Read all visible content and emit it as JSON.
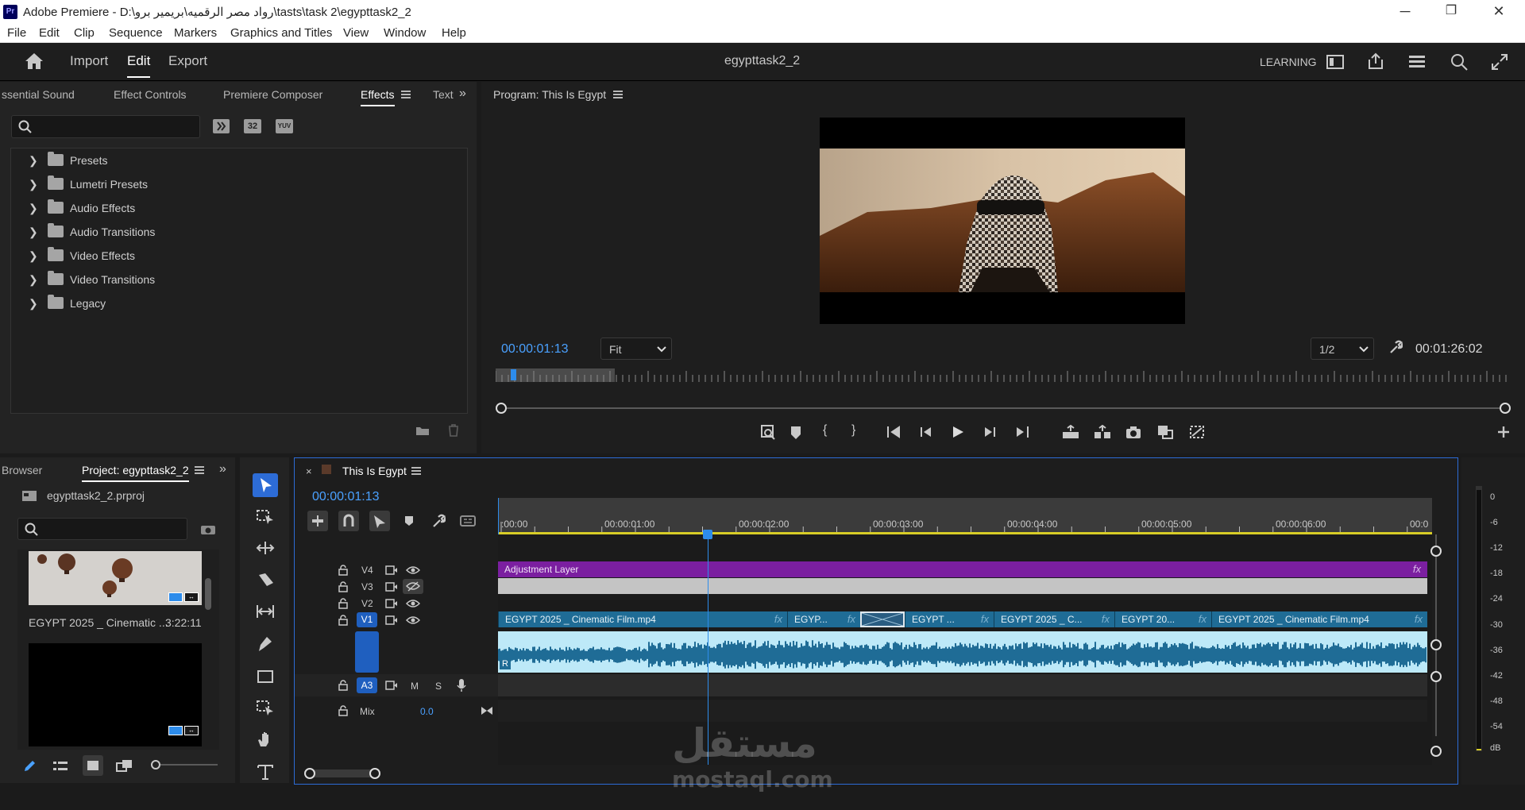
{
  "title_bar": {
    "app_logo": "Pr",
    "title": "Adobe Premiere - D:\\رواد مصر الرقميه\\بريمير برو\\tasts\\task 2\\egypttask2_2",
    "minimize": "─",
    "maximize": "❐",
    "close": "✕"
  },
  "menu": [
    "File",
    "Edit",
    "Clip",
    "Sequence",
    "Markers",
    "Graphics and Titles",
    "View",
    "Window",
    "Help"
  ],
  "workspace": {
    "tabs": [
      "Import",
      "Edit",
      "Export"
    ],
    "active": "Edit",
    "project_title": "egypttask2_2",
    "learning": "LEARNING"
  },
  "effects_panel": {
    "tabs": [
      "ssential Sound",
      "Effect Controls",
      "Premiere Composer",
      "Effects",
      "Text"
    ],
    "active_tab": "Effects",
    "search_placeholder": "",
    "filter_icons": [
      "accelerated-effects-icon",
      "32-bit-icon",
      "yuv-icon"
    ],
    "filter_labels": [
      "32",
      "YUV"
    ],
    "tree": [
      "Presets",
      "Lumetri Presets",
      "Audio Effects",
      "Audio Transitions",
      "Video Effects",
      "Video Transitions",
      "Legacy"
    ]
  },
  "program_monitor": {
    "title": "Program: This Is Egypt",
    "timecode": "00:00:01:13",
    "zoom": "Fit",
    "resolution": "1/2",
    "duration": "00:01:26:02",
    "playhead_fraction": 0.017
  },
  "project_panel": {
    "tabs": [
      "Browser",
      "Project: egypttask2_2"
    ],
    "active_tab": "Project: egypttask2_2",
    "file_name": "egypttask2_2.prproj",
    "search_placeholder": "",
    "items": [
      {
        "name": "EGYPT 2025 _ Cinematic ...",
        "duration": "3:22:11"
      }
    ]
  },
  "timeline": {
    "close": "×",
    "sequence_name": "This Is Egypt",
    "timecode": "00:00:01:13",
    "ruler_labels": [
      ":00:00",
      "00:00:01:00",
      "00:00:02:00",
      "00:00:03:00",
      "00:00:04:00",
      "00:00:05:00",
      "00:00:06:00",
      "00:0"
    ],
    "playhead_seconds": 1.54,
    "tracks": {
      "v4": "V4",
      "v3": "V3",
      "v2": "V2",
      "v1": "V1",
      "a3": "A3",
      "mute": "M",
      "solo": "S",
      "mix": "Mix",
      "mix_value": "0.0",
      "audio_marker": "R"
    },
    "v4_clip": "Adjustment Layer",
    "v1_clips": [
      "EGYPT 2025 _ Cinematic Film.mp4",
      "EGYP...",
      "",
      "EGYPT ...",
      "EGYPT 2025 _ C...",
      "EGYPT 20...",
      "EGYPT 2025 _ Cinematic Film.mp4"
    ],
    "fx_label": "fx"
  },
  "audio_meter": {
    "scale": [
      "0",
      "-6",
      "-12",
      "-18",
      "-24",
      "-30",
      "-36",
      "-42",
      "-48",
      "-54",
      "dB"
    ]
  },
  "watermark": {
    "arabic": "مستقل",
    "latin": "mostaql.com"
  },
  "colors": {
    "accent_blue": "#2d8ceb",
    "timecode_blue": "#4aa1ff",
    "clip_blue": "#1f6c96",
    "adjustment_purple": "#7b1fa0",
    "audio_wave": "#1f6c96",
    "audio_bg": "#bde9f8"
  }
}
